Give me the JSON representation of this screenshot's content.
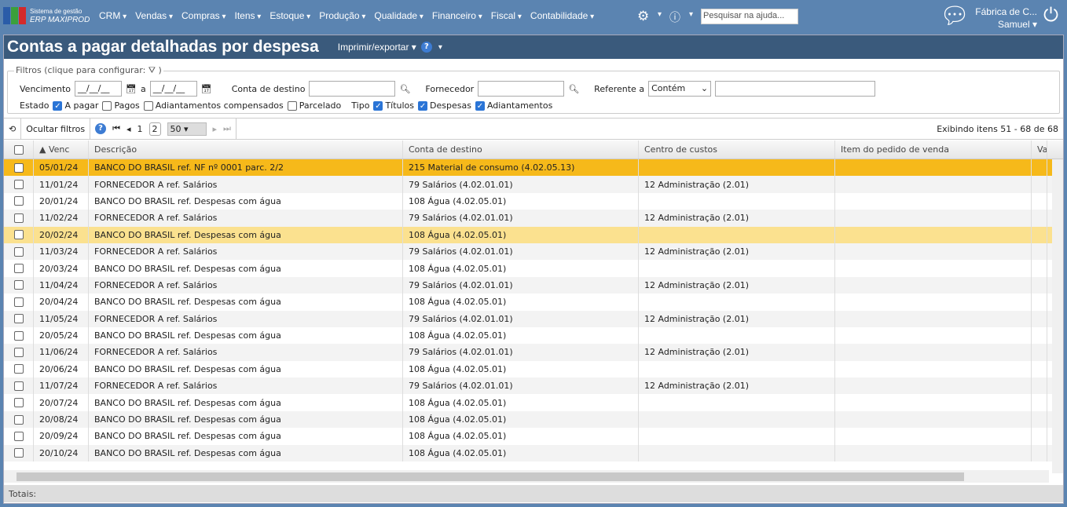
{
  "header": {
    "brand_line1": "Sistema de gestão",
    "brand_line2": "ERP MAXIPROD",
    "menu": [
      "CRM",
      "Vendas",
      "Compras",
      "Itens",
      "Estoque",
      "Produção",
      "Qualidade",
      "Financeiro",
      "Fiscal",
      "Contabilidade"
    ],
    "search_placeholder": "Pesquisar na ajuda...",
    "company": "Fábrica de C...",
    "user": "Samuel"
  },
  "page": {
    "title": "Contas a pagar detalhadas por despesa",
    "export": "Imprimir/exportar ▾"
  },
  "filters": {
    "legend": "Filtros (clique para configurar: ⛛ )",
    "vencimento": "Vencimento",
    "date_from": "__/__/__",
    "a": "a",
    "date_to": "__/__/__",
    "conta": "Conta de destino",
    "fornecedor": "Fornecedor",
    "referente": "Referente a",
    "referente_op": "Contém",
    "estado": "Estado",
    "estados": [
      {
        "label": "A pagar",
        "on": true
      },
      {
        "label": "Pagos",
        "on": false
      },
      {
        "label": "Adiantamentos compensados",
        "on": false
      },
      {
        "label": "Parcelado",
        "on": false
      }
    ],
    "tipo": "Tipo",
    "tipos": [
      {
        "label": "Títulos",
        "on": true
      },
      {
        "label": "Despesas",
        "on": true
      },
      {
        "label": "Adiantamentos",
        "on": true
      }
    ]
  },
  "toolbar": {
    "hide_filters": "Ocultar filtros",
    "page1": "1",
    "page2": "2",
    "page_size": "50",
    "info": "Exibindo itens 51 - 68 de 68"
  },
  "columns": [
    "▲ Venc",
    "Descrição",
    "Conta de destino",
    "Centro de custos",
    "Item do pedido de venda",
    "Va"
  ],
  "rows": [
    [
      "05/01/24",
      "BANCO DO BRASIL ref. NF nº 0001 parc. 2/2",
      "215 Material de consumo (4.02.05.13)",
      ""
    ],
    [
      "11/01/24",
      "FORNECEDOR A ref. Salários",
      "79 Salários (4.02.01.01)",
      "12 Administração (2.01)"
    ],
    [
      "20/01/24",
      "BANCO DO BRASIL ref. Despesas com água",
      "108 Água (4.02.05.01)",
      ""
    ],
    [
      "11/02/24",
      "FORNECEDOR A ref. Salários",
      "79 Salários (4.02.01.01)",
      "12 Administração (2.01)"
    ],
    [
      "20/02/24",
      "BANCO DO BRASIL ref. Despesas com água",
      "108 Água (4.02.05.01)",
      ""
    ],
    [
      "11/03/24",
      "FORNECEDOR A ref. Salários",
      "79 Salários (4.02.01.01)",
      "12 Administração (2.01)"
    ],
    [
      "20/03/24",
      "BANCO DO BRASIL ref. Despesas com água",
      "108 Água (4.02.05.01)",
      ""
    ],
    [
      "11/04/24",
      "FORNECEDOR A ref. Salários",
      "79 Salários (4.02.01.01)",
      "12 Administração (2.01)"
    ],
    [
      "20/04/24",
      "BANCO DO BRASIL ref. Despesas com água",
      "108 Água (4.02.05.01)",
      ""
    ],
    [
      "11/05/24",
      "FORNECEDOR A ref. Salários",
      "79 Salários (4.02.01.01)",
      "12 Administração (2.01)"
    ],
    [
      "20/05/24",
      "BANCO DO BRASIL ref. Despesas com água",
      "108 Água (4.02.05.01)",
      ""
    ],
    [
      "11/06/24",
      "FORNECEDOR A ref. Salários",
      "79 Salários (4.02.01.01)",
      "12 Administração (2.01)"
    ],
    [
      "20/06/24",
      "BANCO DO BRASIL ref. Despesas com água",
      "108 Água (4.02.05.01)",
      ""
    ],
    [
      "11/07/24",
      "FORNECEDOR A ref. Salários",
      "79 Salários (4.02.01.01)",
      "12 Administração (2.01)"
    ],
    [
      "20/07/24",
      "BANCO DO BRASIL ref. Despesas com água",
      "108 Água (4.02.05.01)",
      ""
    ],
    [
      "20/08/24",
      "BANCO DO BRASIL ref. Despesas com água",
      "108 Água (4.02.05.01)",
      ""
    ],
    [
      "20/09/24",
      "BANCO DO BRASIL ref. Despesas com água",
      "108 Água (4.02.05.01)",
      ""
    ],
    [
      "20/10/24",
      "BANCO DO BRASIL ref. Despesas com água",
      "108 Água (4.02.05.01)",
      ""
    ]
  ],
  "totals": "Totais:"
}
